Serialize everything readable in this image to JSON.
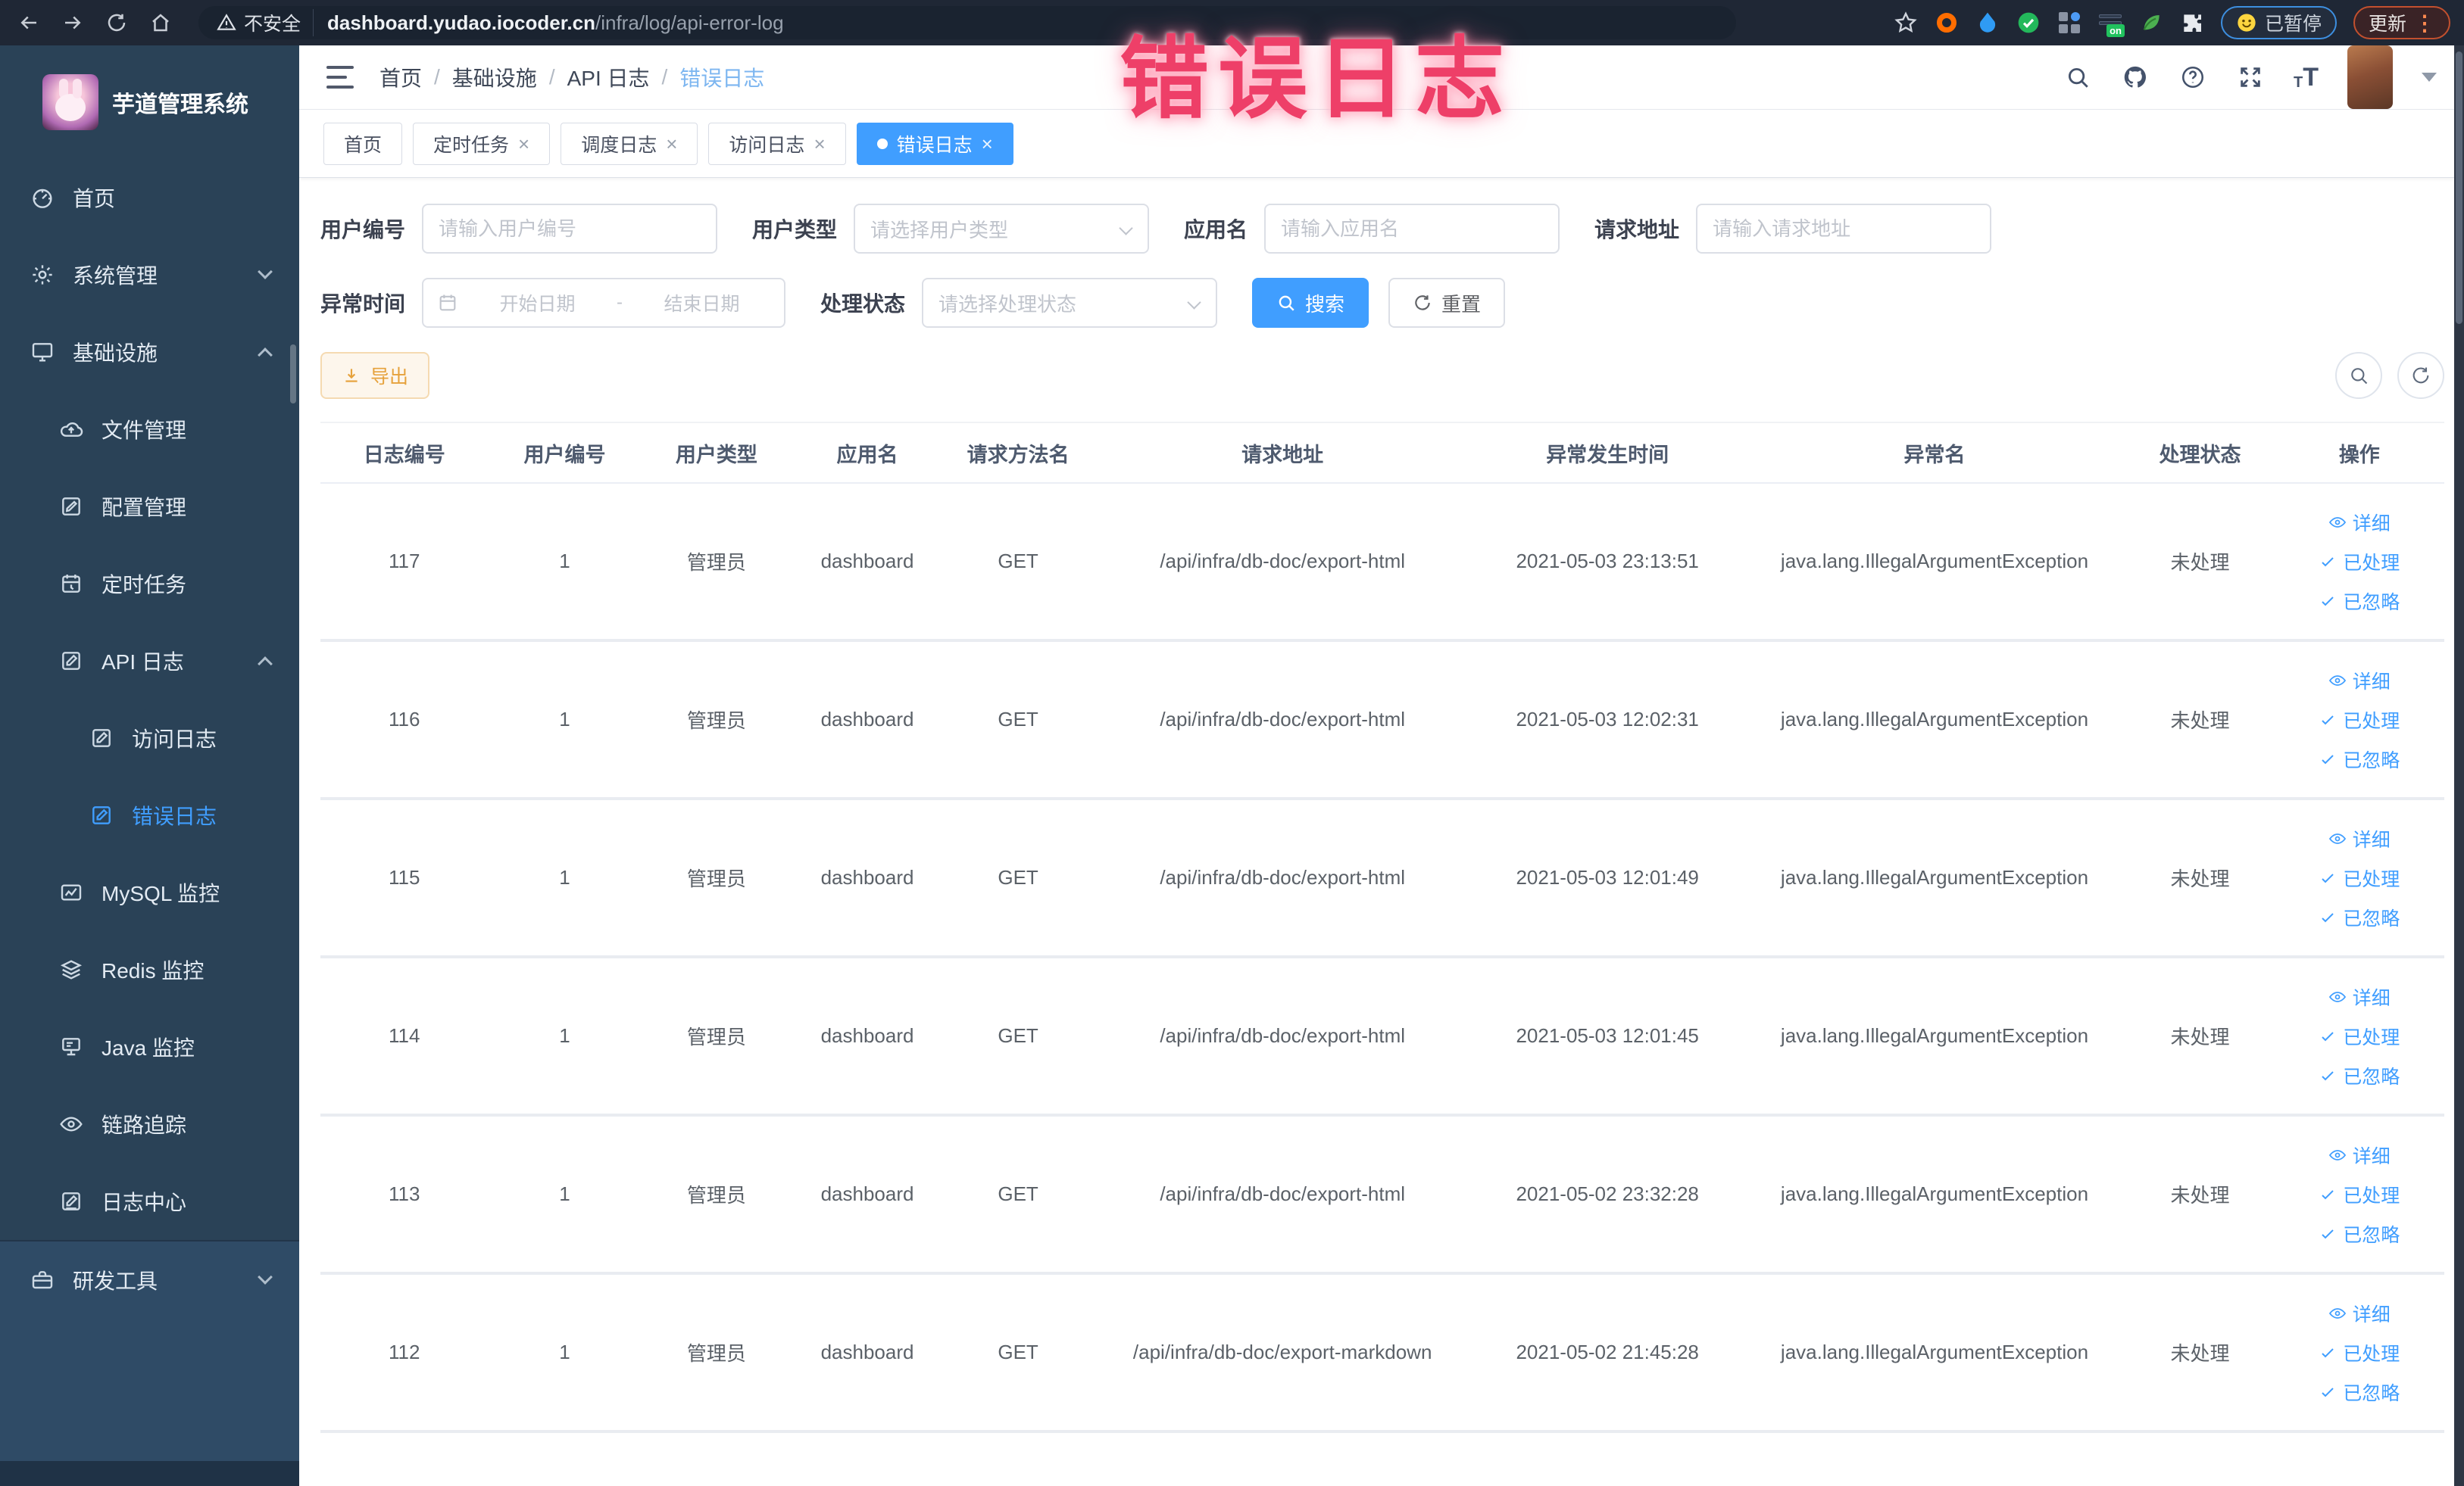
{
  "colors": {
    "accent": "#409eff",
    "warning": "#e6a23c",
    "annotation_pink": "#ee3f68",
    "sidebar_bg": "#2a4257",
    "chrome_bg": "#1f2735"
  },
  "browser": {
    "security_label": "不安全",
    "url_host": "dashboard.yudao.iocoder.cn",
    "url_path": "/infra/log/api-error-log",
    "ext_badge": "on",
    "paused_badge": "已暂停",
    "update_badge": "更新"
  },
  "annotation": {
    "title": "错误日志"
  },
  "app": {
    "title": "芋道管理系统"
  },
  "sidebar": {
    "items": [
      {
        "label": "首页"
      },
      {
        "label": "系统管理"
      },
      {
        "label": "基础设施"
      },
      {
        "label": "文件管理"
      },
      {
        "label": "配置管理"
      },
      {
        "label": "定时任务"
      },
      {
        "label": "API 日志"
      },
      {
        "label": "访问日志"
      },
      {
        "label": "错误日志"
      },
      {
        "label": "MySQL 监控"
      },
      {
        "label": "Redis 监控"
      },
      {
        "label": "Java 监控"
      },
      {
        "label": "链路追踪"
      },
      {
        "label": "日志中心"
      },
      {
        "label": "研发工具"
      }
    ]
  },
  "breadcrumb": {
    "separator": "/",
    "items": [
      "首页",
      "基础设施",
      "API 日志",
      "错误日志"
    ]
  },
  "tabs": [
    {
      "label": "首页"
    },
    {
      "label": "定时任务"
    },
    {
      "label": "调度日志"
    },
    {
      "label": "访问日志"
    },
    {
      "label": "错误日志"
    }
  ],
  "filters": {
    "user_id": {
      "label": "用户编号",
      "placeholder": "请输入用户编号"
    },
    "user_type": {
      "label": "用户类型",
      "placeholder": "请选择用户类型"
    },
    "app_name": {
      "label": "应用名",
      "placeholder": "请输入应用名"
    },
    "request_url": {
      "label": "请求地址",
      "placeholder": "请输入请求地址"
    },
    "exception_time": {
      "label": "异常时间",
      "start_placeholder": "开始日期",
      "separator": "-",
      "end_placeholder": "结束日期"
    },
    "process_status": {
      "label": "处理状态",
      "placeholder": "请选择处理状态"
    },
    "search_button": "搜索",
    "reset_button": "重置"
  },
  "toolbar": {
    "export_button": "导出"
  },
  "table": {
    "headers": [
      "日志编号",
      "用户编号",
      "用户类型",
      "应用名",
      "请求方法名",
      "请求地址",
      "异常发生时间",
      "异常名",
      "处理状态",
      "操作"
    ],
    "actions": [
      "详细",
      "已处理",
      "已忽略"
    ],
    "rows": [
      {
        "id": "117",
        "user_id": "1",
        "user_type": "管理员",
        "app": "dashboard",
        "method": "GET",
        "url": "/api/infra/db-doc/export-html",
        "time": "2021-05-03 23:13:51",
        "exception": "java.lang.IllegalArgumentException",
        "status": "未处理"
      },
      {
        "id": "116",
        "user_id": "1",
        "user_type": "管理员",
        "app": "dashboard",
        "method": "GET",
        "url": "/api/infra/db-doc/export-html",
        "time": "2021-05-03 12:02:31",
        "exception": "java.lang.IllegalArgumentException",
        "status": "未处理"
      },
      {
        "id": "115",
        "user_id": "1",
        "user_type": "管理员",
        "app": "dashboard",
        "method": "GET",
        "url": "/api/infra/db-doc/export-html",
        "time": "2021-05-03 12:01:49",
        "exception": "java.lang.IllegalArgumentException",
        "status": "未处理"
      },
      {
        "id": "114",
        "user_id": "1",
        "user_type": "管理员",
        "app": "dashboard",
        "method": "GET",
        "url": "/api/infra/db-doc/export-html",
        "time": "2021-05-03 12:01:45",
        "exception": "java.lang.IllegalArgumentException",
        "status": "未处理"
      },
      {
        "id": "113",
        "user_id": "1",
        "user_type": "管理员",
        "app": "dashboard",
        "method": "GET",
        "url": "/api/infra/db-doc/export-html",
        "time": "2021-05-02 23:32:28",
        "exception": "java.lang.IllegalArgumentException",
        "status": "未处理"
      },
      {
        "id": "112",
        "user_id": "1",
        "user_type": "管理员",
        "app": "dashboard",
        "method": "GET",
        "url": "/api/infra/db-doc/export-markdown",
        "time": "2021-05-02 21:45:28",
        "exception": "java.lang.IllegalArgumentException",
        "status": "未处理"
      }
    ]
  }
}
